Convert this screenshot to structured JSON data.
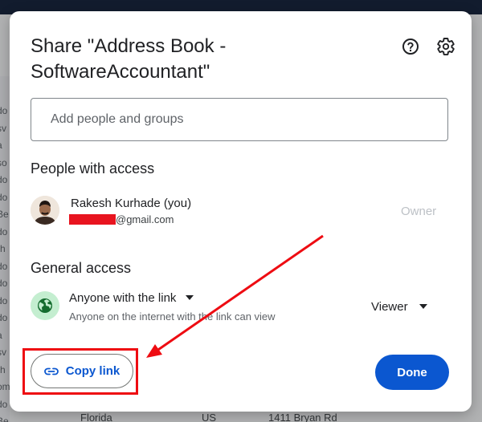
{
  "background": {
    "left_column_cells": [
      "do",
      "sv",
      "a",
      "so",
      "do",
      "do",
      "Be",
      "do",
      "rh",
      "do",
      "do",
      "do",
      "do",
      "a",
      "sv",
      "rh",
      "om",
      "do",
      "Be"
    ],
    "bottom_row": [
      "Florida",
      "US",
      "1411 Bryan Rd"
    ]
  },
  "dialog": {
    "title": "Share \"Address Book - SoftwareAccountant\"",
    "help_icon": "help-circle-icon",
    "settings_icon": "gear-icon",
    "add_people_placeholder": "Add people and groups",
    "people_section_title": "People with access",
    "user": {
      "name": "Rakesh Kurhade (you)",
      "email_visible_part": "@gmail.com",
      "role": "Owner"
    },
    "general_section_title": "General access",
    "general_access": {
      "icon": "globe-icon",
      "setting": "Anyone with the link",
      "description": "Anyone on the internet with the link can view",
      "role": "Viewer"
    },
    "copy_link_label": "Copy link",
    "copy_link_icon": "link-icon",
    "done_label": "Done"
  },
  "colors": {
    "accent": "#0b57d0",
    "annotation": "#ee0c12",
    "globe_bg": "#c4eed0"
  }
}
